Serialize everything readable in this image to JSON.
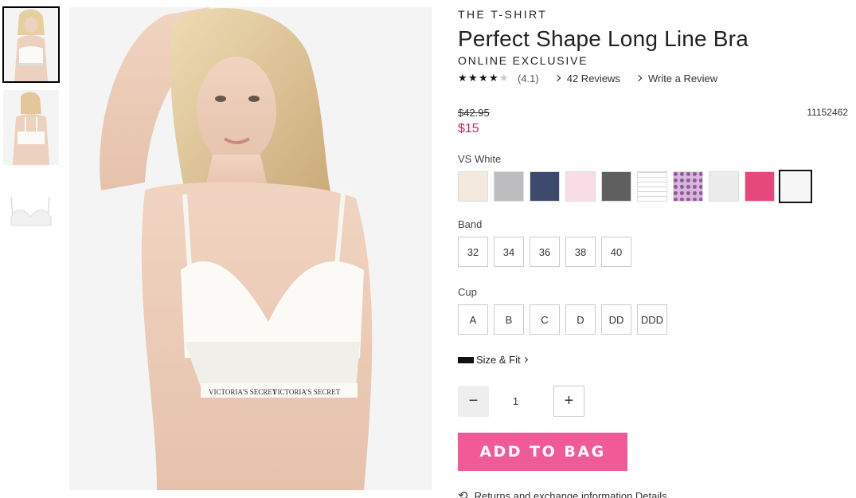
{
  "gallery": {
    "thumbnails": [
      {
        "name": "front-view",
        "active": true
      },
      {
        "name": "back-view",
        "active": false
      },
      {
        "name": "product-only",
        "active": false
      }
    ],
    "main_image_text": "VICTORIA'S SECRET"
  },
  "product": {
    "collection": "THE T-SHIRT",
    "title": "Perfect Shape Long Line Bra",
    "badge": "ONLINE EXCLUSIVE",
    "rating": {
      "stars": 4.1,
      "text": "(4.1)",
      "reviews_link": "42 Reviews",
      "write_review": "Write a Review"
    },
    "price": {
      "original": "$42.95",
      "sale": "$15",
      "sale_color": "#e0195f"
    },
    "sku": "11152462"
  },
  "color": {
    "selected_label": "VS White",
    "swatches": [
      {
        "name": "champagne",
        "color": "#f3e9dc"
      },
      {
        "name": "heather-grey",
        "color": "#bdbdbf"
      },
      {
        "name": "navy",
        "color": "#3d4a6e"
      },
      {
        "name": "pink-logo",
        "color": "#f8dde6"
      },
      {
        "name": "charcoal",
        "color": "#5f5f60"
      },
      {
        "name": "logo-print",
        "color": "#ffffff"
      },
      {
        "name": "purple-leopard",
        "color": "#d9b6dd"
      },
      {
        "name": "light-grey",
        "color": "#ececec"
      },
      {
        "name": "hot-pink",
        "color": "#e7487c"
      },
      {
        "name": "vs-white",
        "color": "#f6f6f6",
        "selected": true
      }
    ]
  },
  "band": {
    "label": "Band",
    "options": [
      "32",
      "34",
      "36",
      "38",
      "40"
    ]
  },
  "cup": {
    "label": "Cup",
    "options": [
      "A",
      "B",
      "C",
      "D",
      "DD",
      "DDD"
    ]
  },
  "size_fit": {
    "label": "Size & Fit",
    "icon": "ruler-icon"
  },
  "quantity": {
    "minus": "−",
    "value": "1",
    "plus": "+"
  },
  "add_to_bag": {
    "label": "ADD TO BAG",
    "color": "#f05a96"
  },
  "returns": {
    "text": "Returns and exchange information.Details",
    "icon": "return-arrows-icon"
  }
}
